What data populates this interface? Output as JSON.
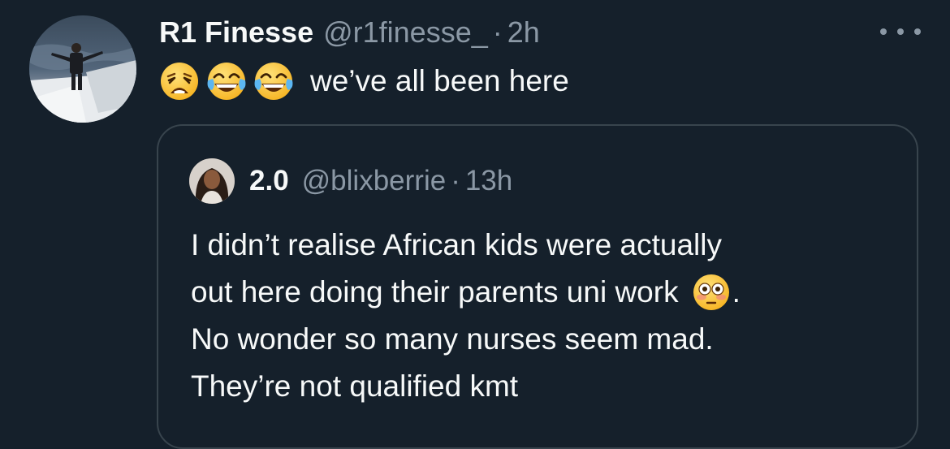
{
  "tweet": {
    "display_name": "R1 Finesse",
    "handle": "@r1finesse_",
    "separator": "·",
    "time": "2h",
    "emojis": [
      "weary-face",
      "face-with-tears-of-joy",
      "face-with-tears-of-joy"
    ],
    "text": "we’ve all been here",
    "more_label": "More"
  },
  "quote": {
    "display_name": "2.0",
    "handle": "@blixberrie",
    "separator": "·",
    "time": "13h",
    "lines": [
      "I didn’t realise African kids were actually",
      "out here doing their parents uni work",
      "No wonder so many nurses seem mad.",
      "They’re not qualified kmt"
    ],
    "inline_emoji": "flushed-face",
    "line2_trailing": "."
  },
  "colors": {
    "background": "#15202b",
    "text_primary": "#f7f9f9",
    "text_secondary": "#8b98a5",
    "border": "#38444d"
  }
}
